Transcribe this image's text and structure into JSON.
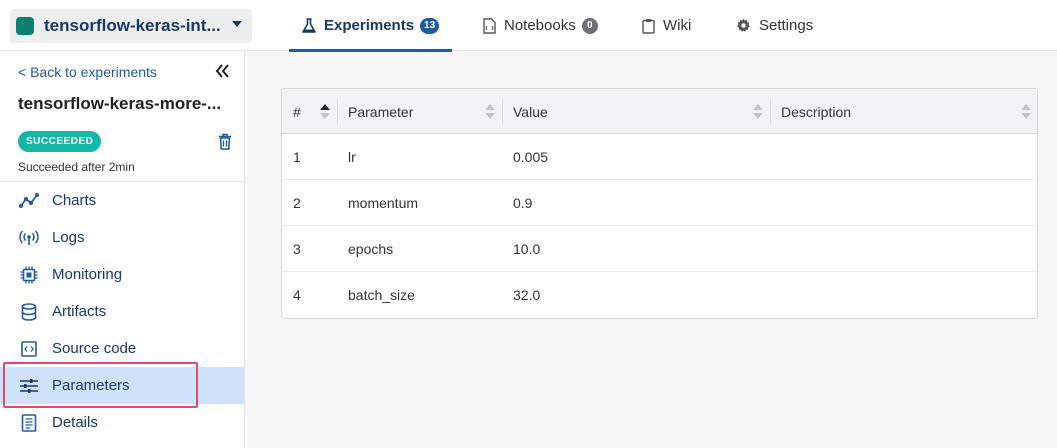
{
  "header": {
    "project_name": "tensorflow-keras-int...",
    "tabs": [
      {
        "label": "Experiments",
        "count": "13"
      },
      {
        "label": "Notebooks",
        "count": "0"
      },
      {
        "label": "Wiki"
      },
      {
        "label": "Settings"
      }
    ]
  },
  "sidebar": {
    "back_label": "< Back to experiments",
    "experiment_name": "tensorflow-keras-more-...",
    "status_badge": "SUCCEEDED",
    "status_text": "Succeeded after 2min",
    "items": [
      {
        "label": "Charts",
        "icon": "chart-line-icon"
      },
      {
        "label": "Logs",
        "icon": "broadcast-icon"
      },
      {
        "label": "Monitoring",
        "icon": "cpu-icon"
      },
      {
        "label": "Artifacts",
        "icon": "database-icon"
      },
      {
        "label": "Source code",
        "icon": "code-file-icon"
      },
      {
        "label": "Parameters",
        "icon": "sliders-icon"
      },
      {
        "label": "Details",
        "icon": "document-icon"
      }
    ],
    "active_item": "Parameters"
  },
  "parameters_table": {
    "columns": [
      "#",
      "Parameter",
      "Value",
      "Description"
    ],
    "rows": [
      {
        "index": "1",
        "parameter": "lr",
        "value": "0.005",
        "description": ""
      },
      {
        "index": "2",
        "parameter": "momentum",
        "value": "0.9",
        "description": ""
      },
      {
        "index": "3",
        "parameter": "epochs",
        "value": "10.0",
        "description": ""
      },
      {
        "index": "4",
        "parameter": "batch_size",
        "value": "32.0",
        "description": ""
      }
    ]
  },
  "colors": {
    "accent": "#1e5aa8",
    "project_square": "#0d7f6f",
    "status_badge": "#14b8a6",
    "active_nav_bg": "#cfe2fb",
    "highlight_border": "#e8476b"
  }
}
